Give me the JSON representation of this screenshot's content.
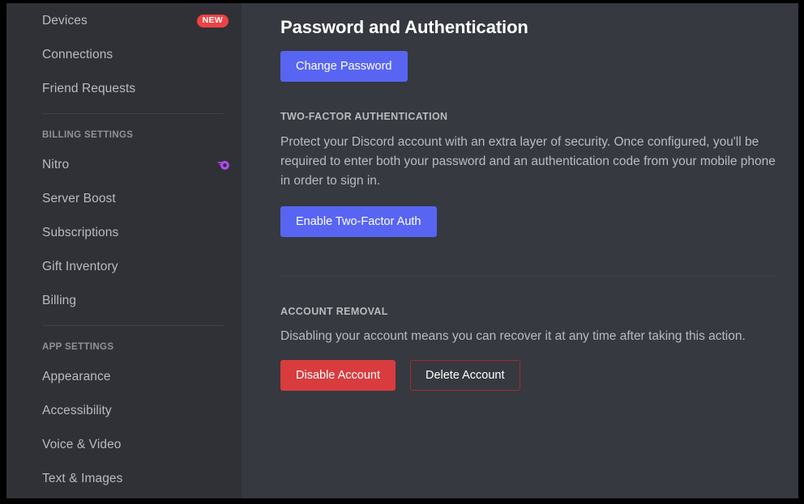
{
  "sidebar": {
    "items": [
      {
        "label": "Devices",
        "badge": "NEW",
        "icon": null
      },
      {
        "label": "Connections",
        "badge": null,
        "icon": null
      },
      {
        "label": "Friend Requests",
        "badge": null,
        "icon": null
      }
    ],
    "billing_section": {
      "header": "BILLING SETTINGS",
      "items": [
        {
          "label": "Nitro",
          "badge": null,
          "icon": "nitro-icon"
        },
        {
          "label": "Server Boost",
          "badge": null,
          "icon": null
        },
        {
          "label": "Subscriptions",
          "badge": null,
          "icon": null
        },
        {
          "label": "Gift Inventory",
          "badge": null,
          "icon": null
        },
        {
          "label": "Billing",
          "badge": null,
          "icon": null
        }
      ]
    },
    "app_section": {
      "header": "APP SETTINGS",
      "items": [
        {
          "label": "Appearance",
          "badge": null,
          "icon": null
        },
        {
          "label": "Accessibility",
          "badge": null,
          "icon": null
        },
        {
          "label": "Voice & Video",
          "badge": null,
          "icon": null
        },
        {
          "label": "Text & Images",
          "badge": null,
          "icon": null
        }
      ]
    }
  },
  "main": {
    "title": "Password and Authentication",
    "change_password_label": "Change Password",
    "two_factor": {
      "heading": "TWO-FACTOR AUTHENTICATION",
      "description": "Protect your Discord account with an extra layer of security. Once configured, you'll be required to enter both your password and an authentication code from your mobile phone in order to sign in.",
      "enable_label": "Enable Two-Factor Auth"
    },
    "account_removal": {
      "heading": "ACCOUNT REMOVAL",
      "description": "Disabling your account means you can recover it at any time after taking this action.",
      "disable_label": "Disable Account",
      "delete_label": "Delete Account"
    }
  },
  "colors": {
    "sidebar_bg": "#2f3136",
    "main_bg": "#36393f",
    "brand_blurple": "#5865f2",
    "danger_red": "#d83c3e",
    "badge_red": "#ed4245",
    "nitro_purple": "#b14aed",
    "text_muted": "#b9bbbe",
    "text_header": "#8e9297",
    "text_white": "#ffffff"
  }
}
